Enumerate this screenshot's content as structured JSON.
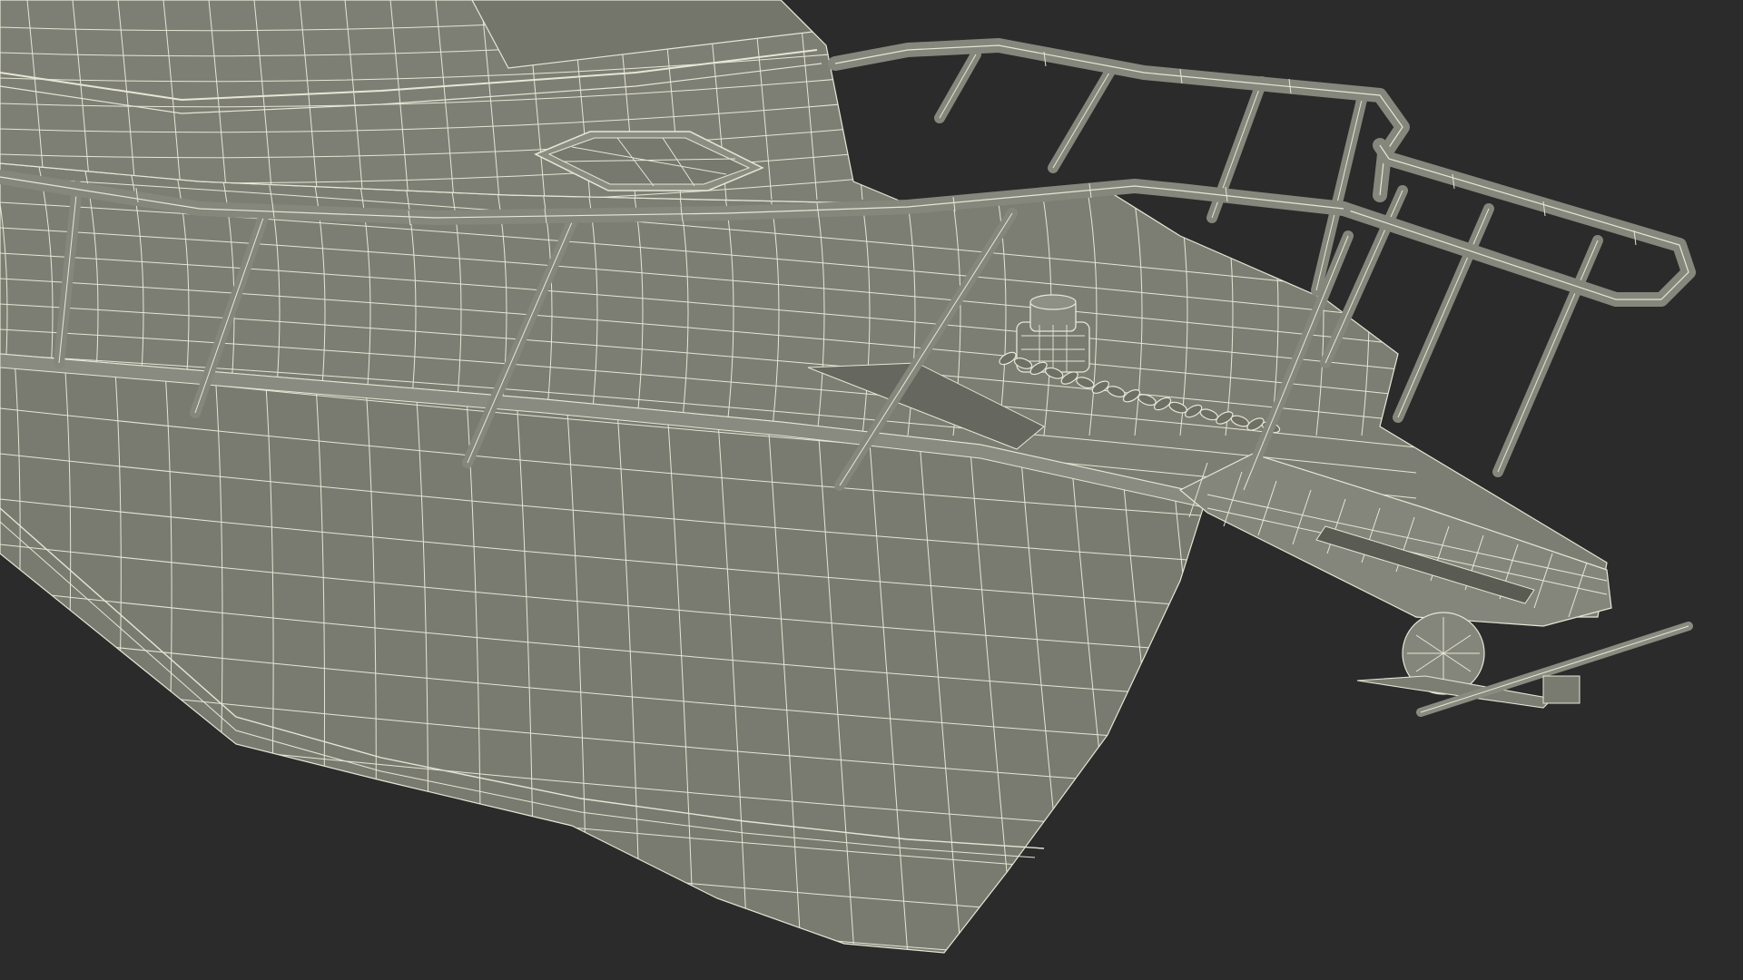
{
  "scene": {
    "subject": "boat-bow-wireframe-render",
    "colors": {
      "background": "#2b2b2b",
      "surface": "#7b7c71",
      "surface_dark": "#696a60",
      "surface_light": "#8a8b80",
      "wire": "#e6e6d6",
      "rail": "#86877c"
    }
  }
}
